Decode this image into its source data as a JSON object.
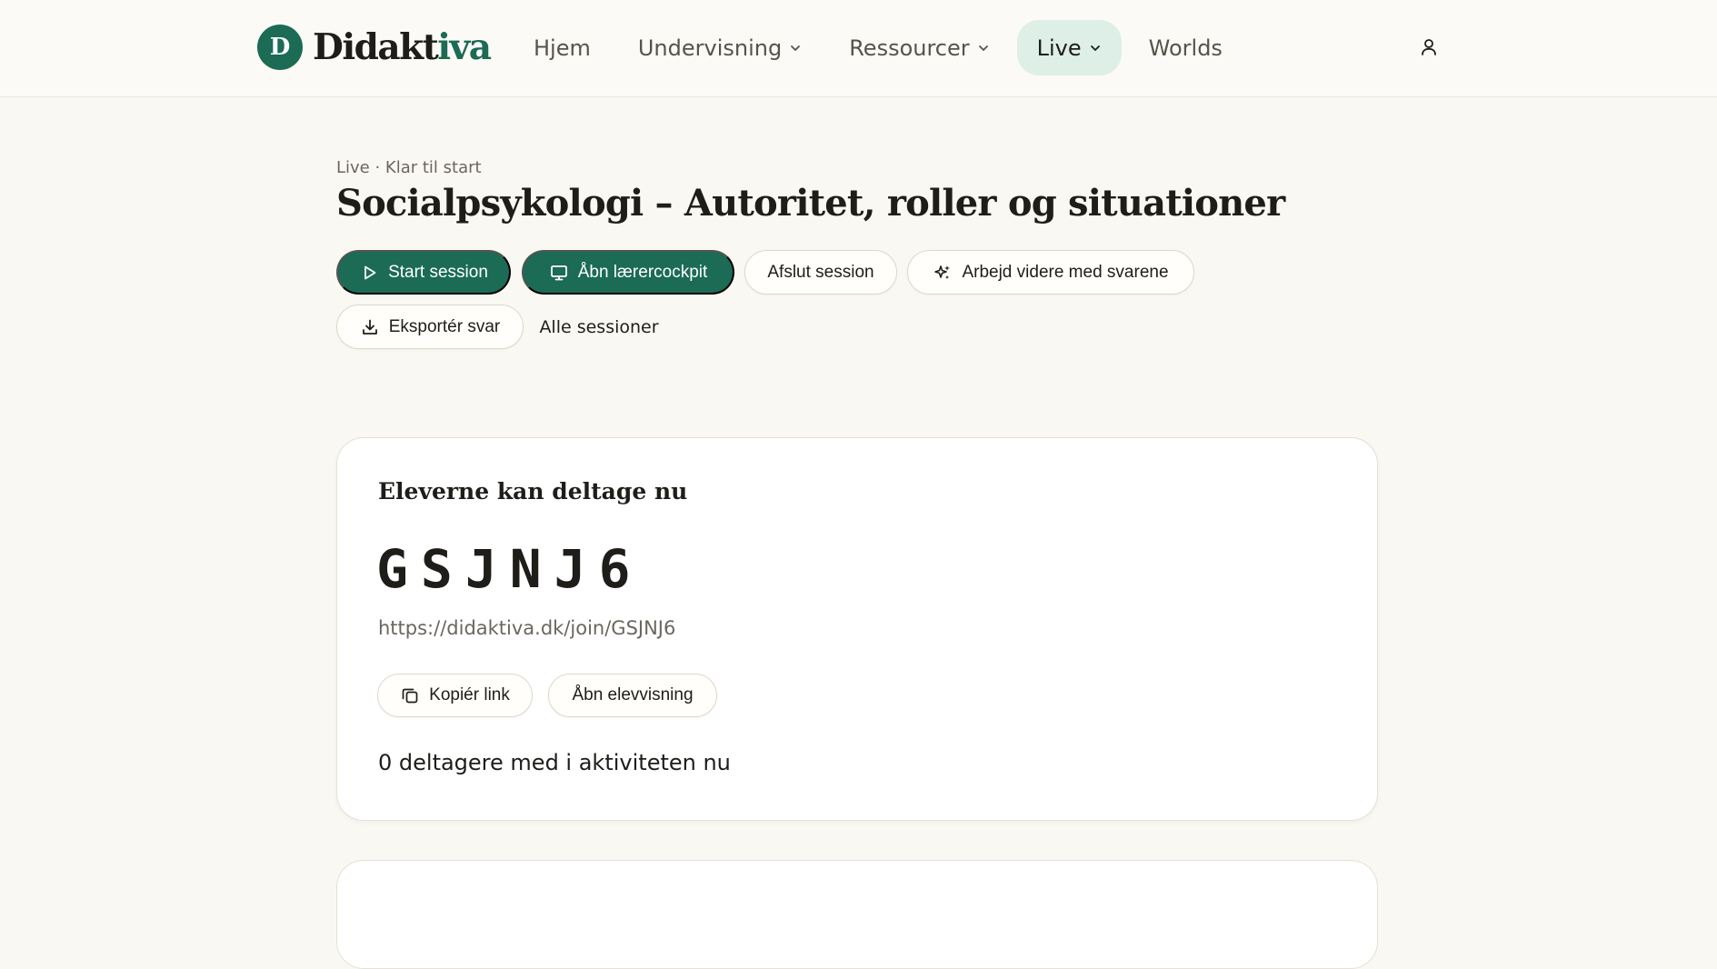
{
  "brand": {
    "mark": "D",
    "name_main": "Didakt",
    "name_accent": "iva"
  },
  "nav": {
    "items": [
      {
        "label": "Hjem"
      },
      {
        "label": "Undervisning"
      },
      {
        "label": "Ressourcer"
      },
      {
        "label": "Live"
      },
      {
        "label": "Worlds"
      }
    ]
  },
  "colors": {
    "brand": "#1b6b55",
    "active_nav_bg": "#ddefe7",
    "page_bg": "#faf8f3"
  },
  "session": {
    "breadcrumb": "Live · Klar til start",
    "title": "Socialpsykologi – Autoritet, roller og situationer",
    "actions": {
      "start": "Start session",
      "cockpit": "Åbn lærercockpit",
      "end": "Afslut session",
      "continue": "Arbejd videre med svarene",
      "export": "Eksportér svar",
      "all": "Alle sessioner"
    }
  },
  "join_card": {
    "heading": "Eleverne kan deltage nu",
    "code": "GSJNJ6",
    "url": "https://didaktiva.dk/join/GSJNJ6",
    "copy_link": "Kopiér link",
    "open_student_view": "Åbn elevvisning",
    "participants": "0 deltagere med i aktiviteten nu"
  }
}
